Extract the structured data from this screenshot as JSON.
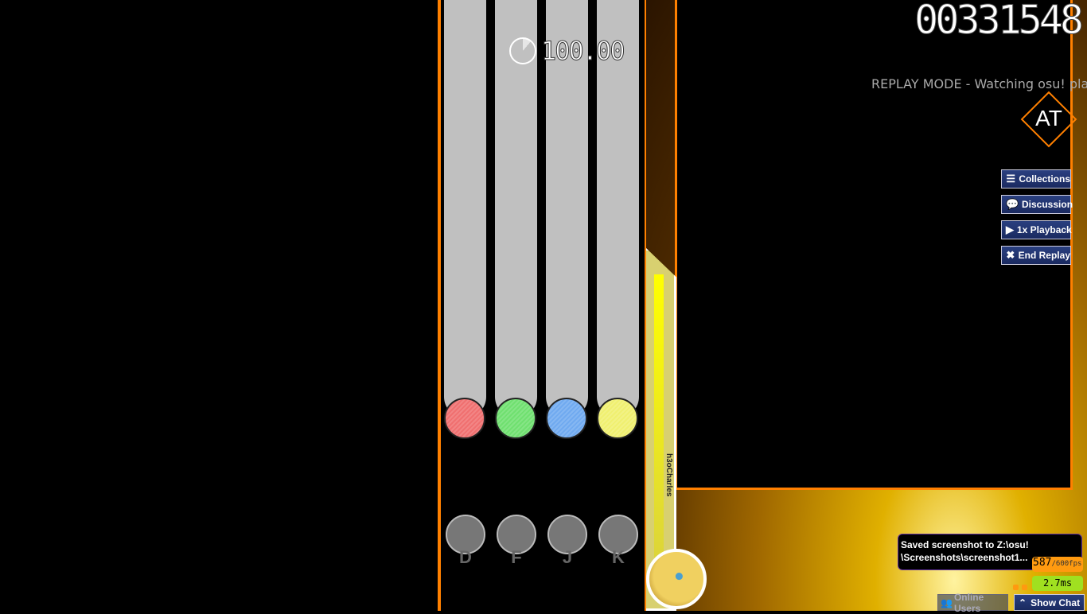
{
  "hud": {
    "score": "00331548",
    "accuracy": "100.00",
    "replay_banner": "REPLAY MODE - Watching osu! pla",
    "mod": "AT",
    "player_name": "h3oCharles"
  },
  "keys": [
    "D",
    "F",
    "J",
    "K"
  ],
  "note_colors": [
    "#f07070",
    "#70e070",
    "#70aaf0",
    "#f0f070"
  ],
  "accent_color": "#ff8000",
  "menu": [
    {
      "label": "Collections",
      "icon": "list-icon"
    },
    {
      "label": "Discussion",
      "icon": "speech-bubbles-icon"
    },
    {
      "label": "1x Playback",
      "icon": "play-icon"
    },
    {
      "label": "End Replay",
      "icon": "close-icon"
    }
  ],
  "toast": {
    "line1": "Saved screenshot to Z:\\osu!",
    "line2": "\\Screenshots\\screenshot1..."
  },
  "perf": {
    "fps": "587",
    "fps_max": "/600fps",
    "frametime": "2.7ms"
  },
  "bottom": {
    "online_users": "Online Users",
    "show_chat": "Show Chat"
  }
}
